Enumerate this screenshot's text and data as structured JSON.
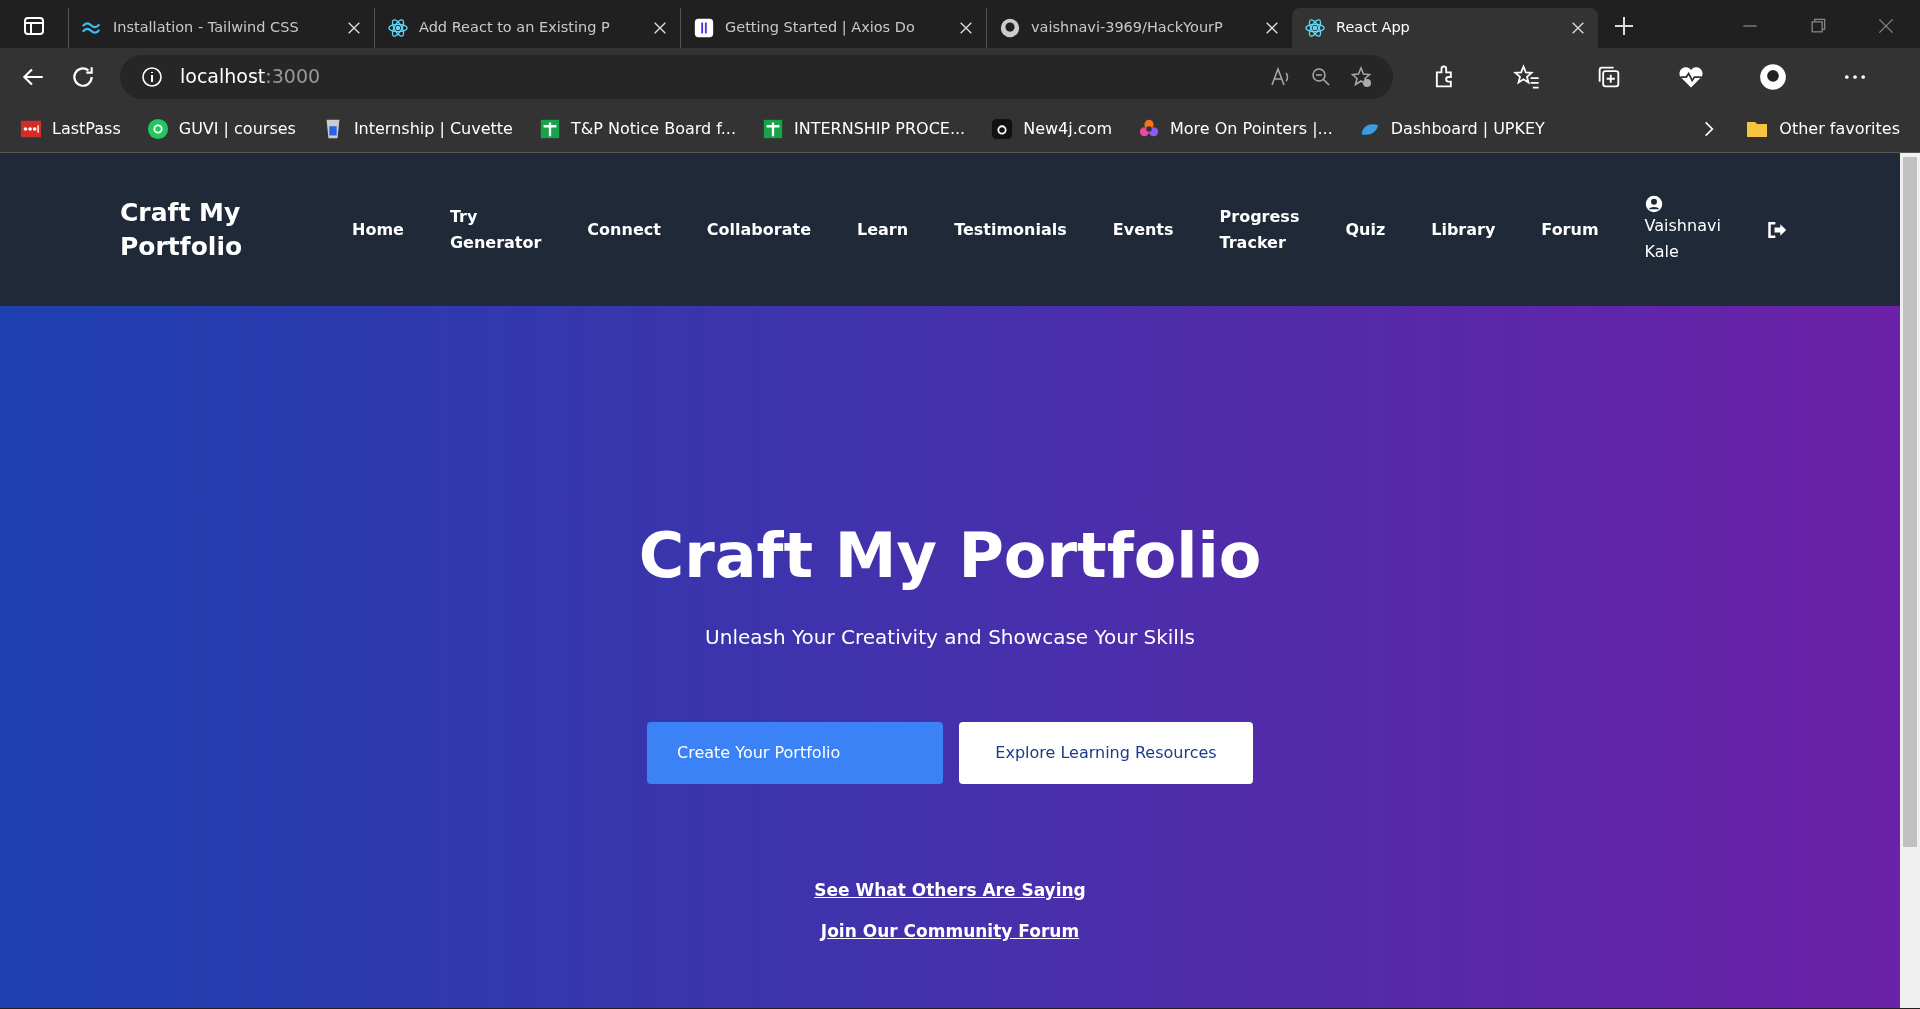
{
  "browser": {
    "tabs": [
      {
        "title": "Installation - Tailwind CSS",
        "selected": false
      },
      {
        "title": "Add React to an Existing P",
        "selected": false
      },
      {
        "title": "Getting Started | Axios Do",
        "selected": false
      },
      {
        "title": "vaishnavi-3969/HackYourP",
        "selected": false
      },
      {
        "title": "React App",
        "selected": true
      }
    ],
    "address": {
      "host": "localhost",
      "port": ":3000"
    },
    "bookmarks": [
      "LastPass",
      "GUVI | courses",
      "Internship | Cuvette",
      "T&P Notice Board f...",
      "INTERNSHIP PROCE...",
      "New4j.com",
      "More On Pointers |...",
      "Dashboard | UPKEY"
    ],
    "other_favorites": "Other favorites"
  },
  "navbar": {
    "brand": "Craft My Portfolio",
    "links": [
      "Home",
      "Try Generator",
      "Connect",
      "Collaborate",
      "Learn",
      "Testimonials",
      "Events",
      "Progress Tracker",
      "Quiz",
      "Library",
      "Forum"
    ],
    "user": "Vaishnavi Kale"
  },
  "hero": {
    "title": "Craft My Portfolio",
    "subtitle": "Unleash Your Creativity and Showcase Your Skills",
    "buttons": [
      {
        "label": "Create Your Portfolio",
        "kind": "primary"
      },
      {
        "label": "Explore Learning Resources",
        "kind": "light"
      }
    ],
    "links": [
      "See What Others Are Saying",
      "Join Our Community Forum"
    ]
  }
}
